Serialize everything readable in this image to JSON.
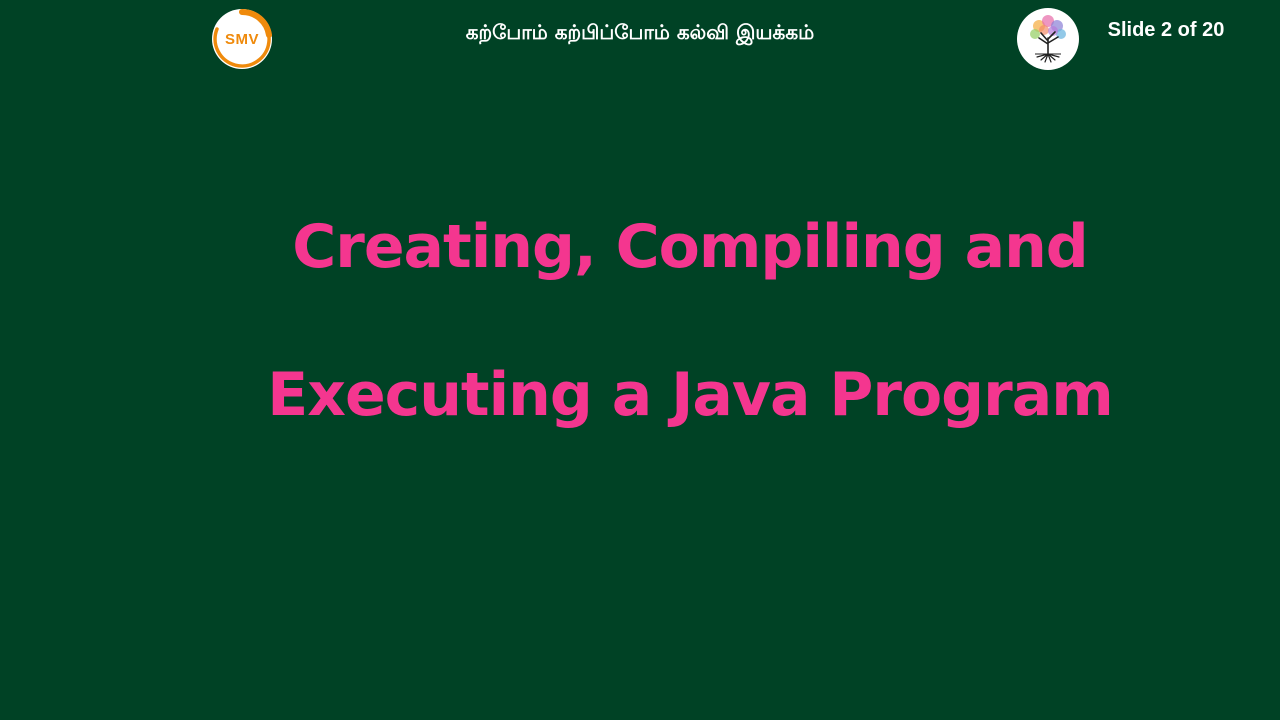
{
  "header": {
    "logo_text": "SMV",
    "title": "கற்போம் கற்பிப்போம் கல்வி இயக்கம்",
    "slide_counter": "Slide 2 of 20"
  },
  "main": {
    "title_line_1": "Creating, Compiling and",
    "title_line_2": "Executing a Java Program"
  },
  "colors": {
    "background": "#004225",
    "title": "#f4368f",
    "logo_accent": "#ef8a0c",
    "header_text": "#ffffff"
  },
  "icons": {
    "left_logo": "smv-logo-icon",
    "right_logo": "tree-emblem-icon"
  }
}
